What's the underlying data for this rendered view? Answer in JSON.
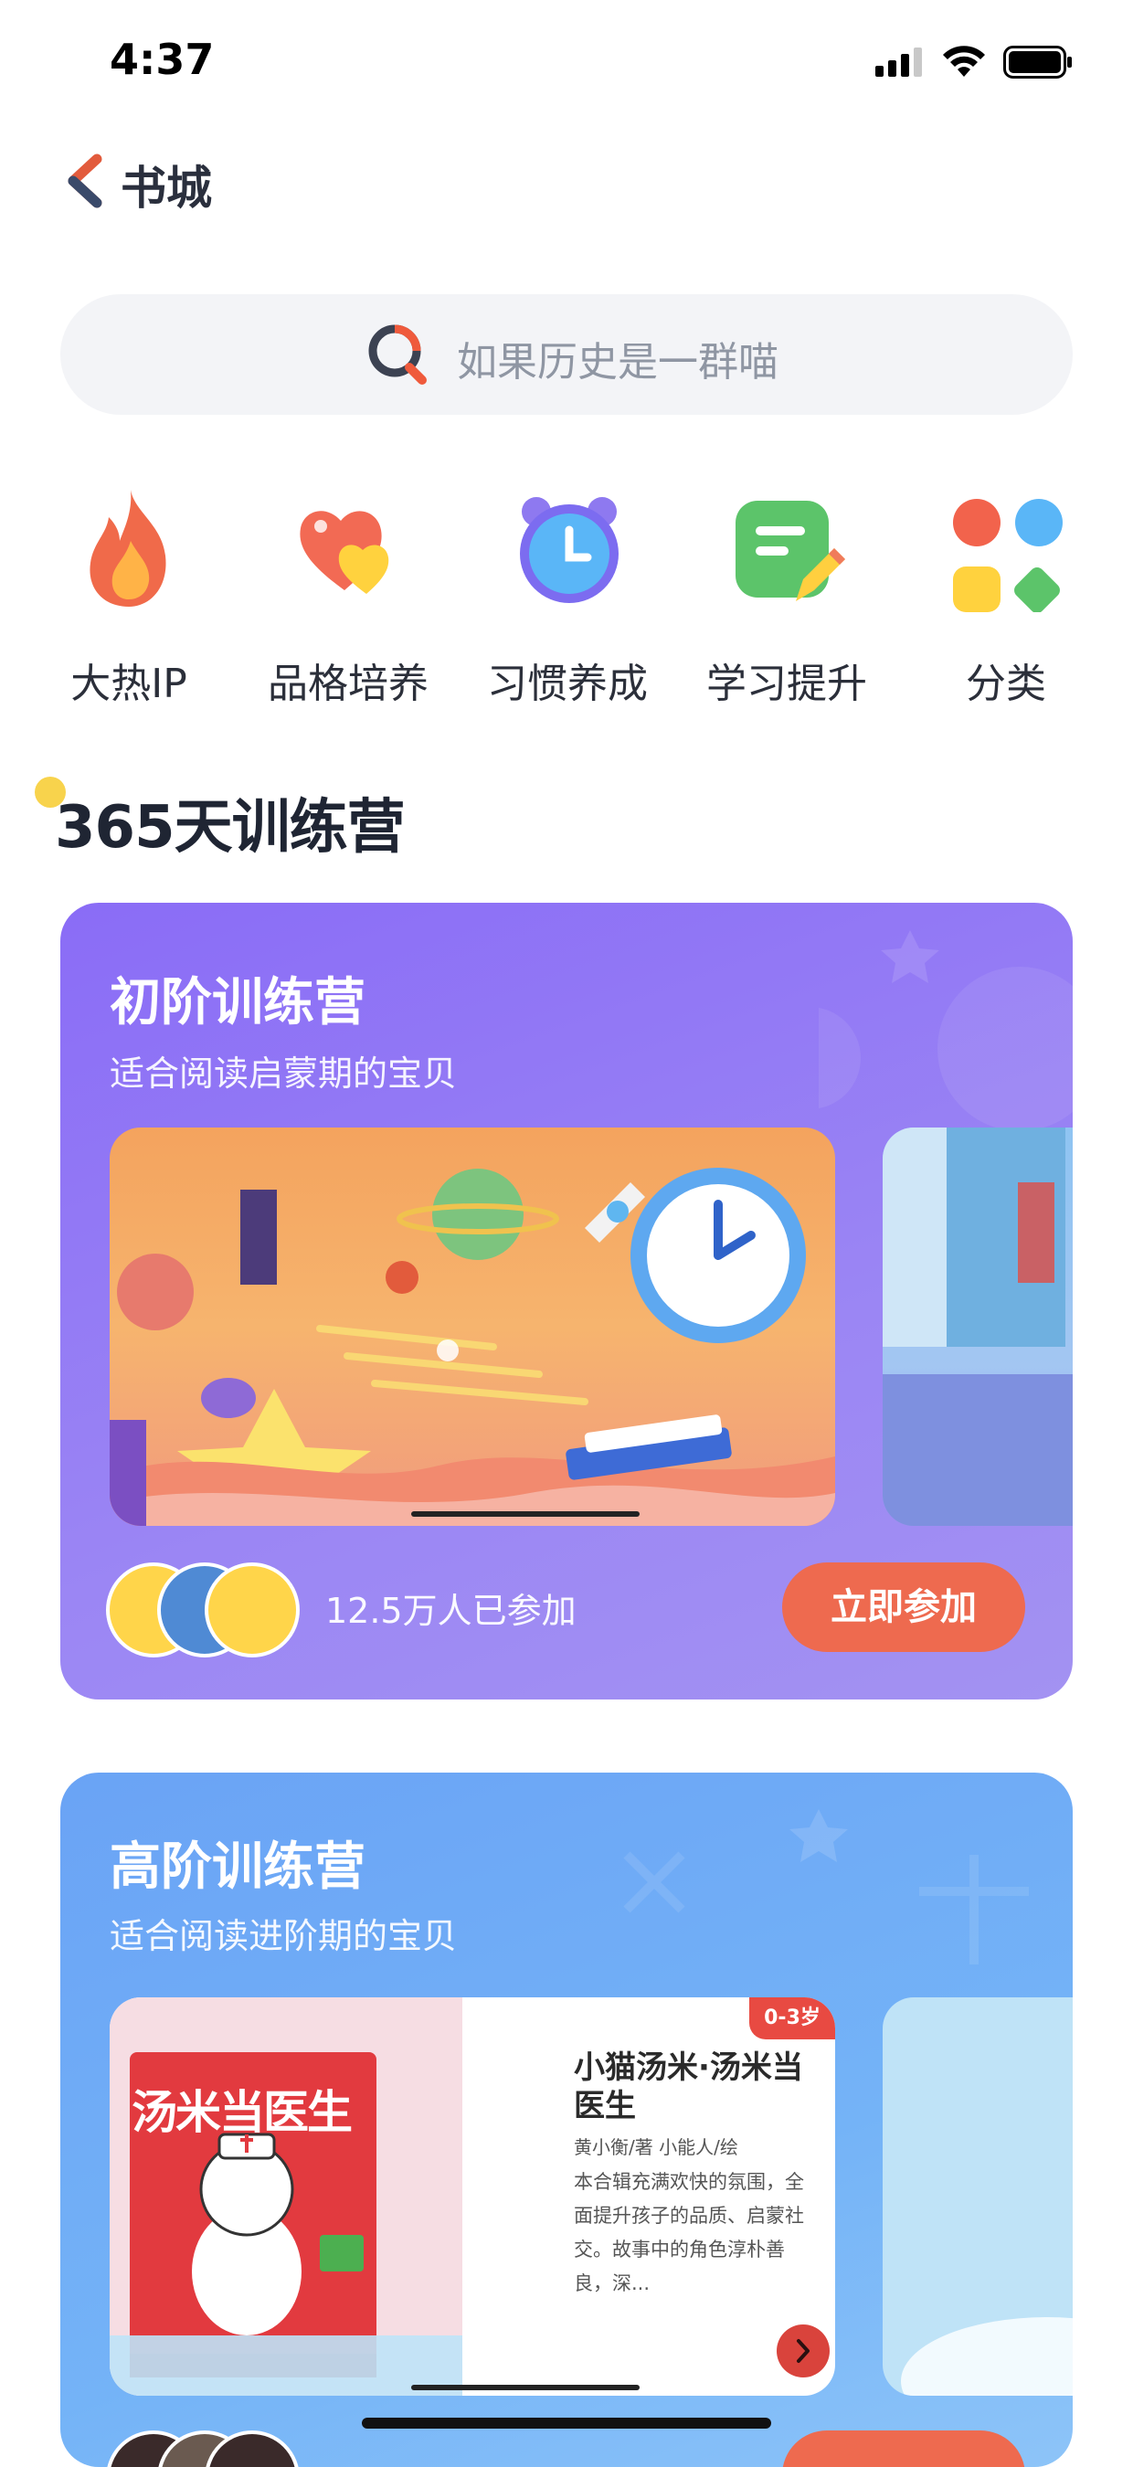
{
  "status": {
    "time": "4:37"
  },
  "nav": {
    "title": "书城"
  },
  "search": {
    "placeholder": "如果历史是一群喵"
  },
  "categories": [
    {
      "label": "大热IP",
      "icon": "fire-icon"
    },
    {
      "label": "品格培养",
      "icon": "hearts-icon"
    },
    {
      "label": "习惯养成",
      "icon": "alarm-clock-icon"
    },
    {
      "label": "学习提升",
      "icon": "notepad-pencil-icon"
    },
    {
      "label": "分类",
      "icon": "grid-icon"
    }
  ],
  "section": {
    "title": "365天训练营"
  },
  "camps": [
    {
      "title": "初阶训练营",
      "subtitle": "适合阅读启蒙期的宝贝",
      "joined": "12.5万人已参加",
      "button": "立即参加",
      "color": "#8a6cf6"
    },
    {
      "title": "高阶训练营",
      "subtitle": "适合阅读进阶期的宝贝",
      "color": "#6aa3f5",
      "book": {
        "age": "0-3岁",
        "title": "小猫汤米·汤米当医生",
        "author": "黄小衡/著 小能人/绘",
        "desc": "本合辑充满欢快的氛围，全面提升孩子的品质、启蒙社交。故事中的角色淳朴善良，深...",
        "cover_text": "汤米当医生"
      }
    }
  ],
  "colors": {
    "accent": "#ee6a4f",
    "back": "#e25b3c"
  }
}
